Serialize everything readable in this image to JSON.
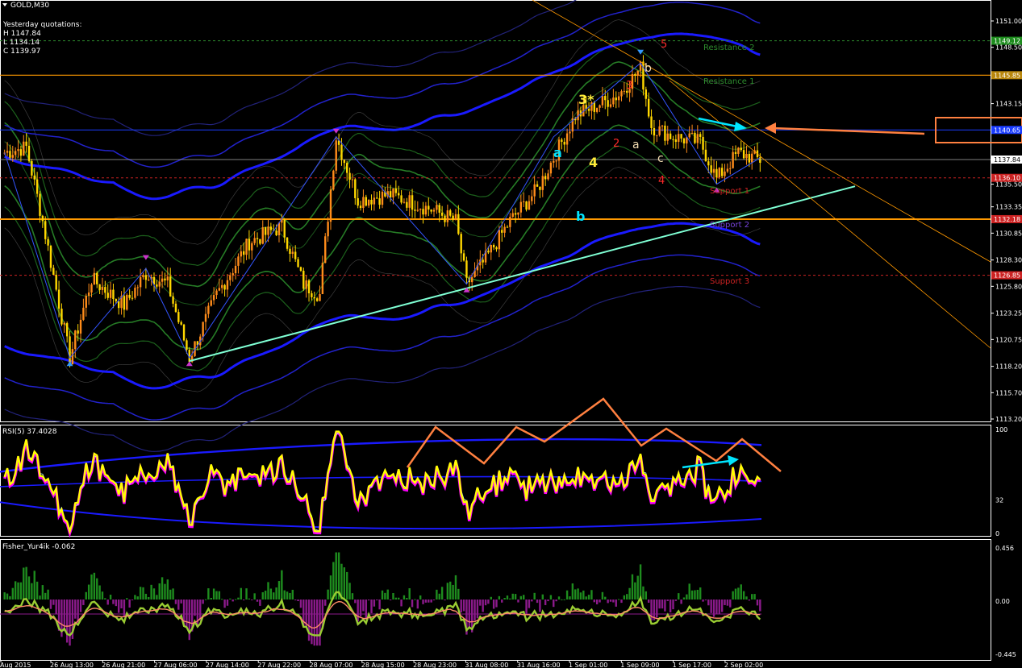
{
  "window_title": "GOLD,M30",
  "quotes": {
    "header": "Yesterday quotations:",
    "high": "H 1147.84",
    "low": "L 1134.14",
    "close": "C 1139.97"
  },
  "indicators": {
    "rsi_label": "RSI(5) 37.4028",
    "fisher_label": "Fisher_Yur4ik -0.062"
  },
  "colors": {
    "background": "#000000",
    "bull_candle": "#ff8c1a",
    "bear_candle": "#ffd700",
    "band_blue": "#1a1aff",
    "band_green": "#1f8a1f",
    "trendline": "#7fffd4",
    "resistance": "#2e8b2e",
    "support": "#cc2222",
    "orange_level": "#ff9900",
    "rsi_line": "#ffff00",
    "rsi_shadow": "#ff00ff",
    "fisher_pos": "#1e8c1e",
    "fisher_neg": "#8b1a8b",
    "fisher_line": "#9acd32",
    "fisher_signal": "#ff8c69",
    "arrow_cyan": "#00e5ff",
    "arrow_orange": "#ff8040"
  },
  "price_axis": {
    "labels": [
      "1151.00",
      "1148.50",
      "1145.80",
      "1143.15",
      "1140.65",
      "1138.00",
      "1135.50",
      "1133.35",
      "1130.85",
      "1128.30",
      "1125.80",
      "1123.25",
      "1120.75",
      "1118.20",
      "1115.70",
      "1113.20"
    ],
    "tags": [
      {
        "text": "1149.12",
        "color": "#1e8c1e",
        "price": 1149.12
      },
      {
        "text": "1145.85",
        "color": "#b8860b",
        "price": 1145.85
      },
      {
        "text": "1140.65",
        "color": "#1a3cff",
        "price": 1140.65
      },
      {
        "text": "1137.84",
        "color": "#ffffff",
        "price": 1137.84
      },
      {
        "text": "1136.10",
        "color": "#cc2222",
        "price": 1136.1
      },
      {
        "text": "1132.18",
        "color": "#cc2222",
        "price": 1132.18
      },
      {
        "text": "1126.85",
        "color": "#cc2222",
        "price": 1126.85
      }
    ]
  },
  "rsi_axis": {
    "labels": [
      "100",
      "32",
      "0"
    ]
  },
  "fisher_axis": {
    "labels": [
      "0.456",
      "0.00",
      "-0.445"
    ]
  },
  "time_axis": {
    "labels": [
      "Aug 2015",
      "26 Aug 13:00",
      "26 Aug 21:00",
      "27 Aug 06:00",
      "27 Aug 14:00",
      "27 Aug 22:00",
      "28 Aug 07:00",
      "28 Aug 15:00",
      "28 Aug 23:00",
      "31 Aug 08:00",
      "31 Aug 16:00",
      "1 Sep 01:00",
      "1 Sep 09:00",
      "1 Sep 17:00",
      "2 Sep 02:00"
    ]
  },
  "levels": {
    "resistance2": "Resistance 2",
    "resistance1": "Resistance 1",
    "support1": "Support 1",
    "support2": "Support 2",
    "support3": "Support 3"
  },
  "wave_labels": {
    "w5": "5",
    "w3red": "3",
    "w3star": "3*",
    "wb_top": "b",
    "wa_cyan": "a",
    "w4_yellow": "4",
    "w2_red": "2",
    "wa_white": "a",
    "wc_white": "c",
    "w4_red": "4",
    "wb_cyan": "b"
  },
  "chart_data": {
    "type": "line",
    "title": "GOLD,M30",
    "symbol": "GOLD",
    "timeframe": "M30",
    "x": [
      "26 Aug 13:00",
      "26 Aug 21:00",
      "27 Aug 06:00",
      "27 Aug 14:00",
      "27 Aug 22:00",
      "28 Aug 07:00",
      "28 Aug 15:00",
      "28 Aug 23:00",
      "31 Aug 08:00",
      "31 Aug 16:00",
      "1 Sep 01:00",
      "1 Sep 09:00",
      "1 Sep 17:00",
      "2 Sep 02:00"
    ],
    "series": [
      {
        "values": [
          1119.0,
          1126.5,
          1127.0,
          1119.0,
          1128.0,
          1130.5,
          1137.5,
          1134.0,
          1126.5,
          1133.5,
          1138.5,
          1143.0,
          1139.5,
          1137.8
        ]
      }
    ],
    "ylim": [
      1113.2,
      1151.0
    ],
    "horizontal_levels": [
      {
        "name": "Resistance 2",
        "value": 1149.12
      },
      {
        "name": "Resistance 1",
        "value": 1145.85
      },
      {
        "name": "Support 1",
        "value": 1136.1
      },
      {
        "name": "Support 2",
        "value": 1132.18
      },
      {
        "name": "Support 3",
        "value": 1126.85
      }
    ],
    "legend": "top-left",
    "grid": false
  }
}
